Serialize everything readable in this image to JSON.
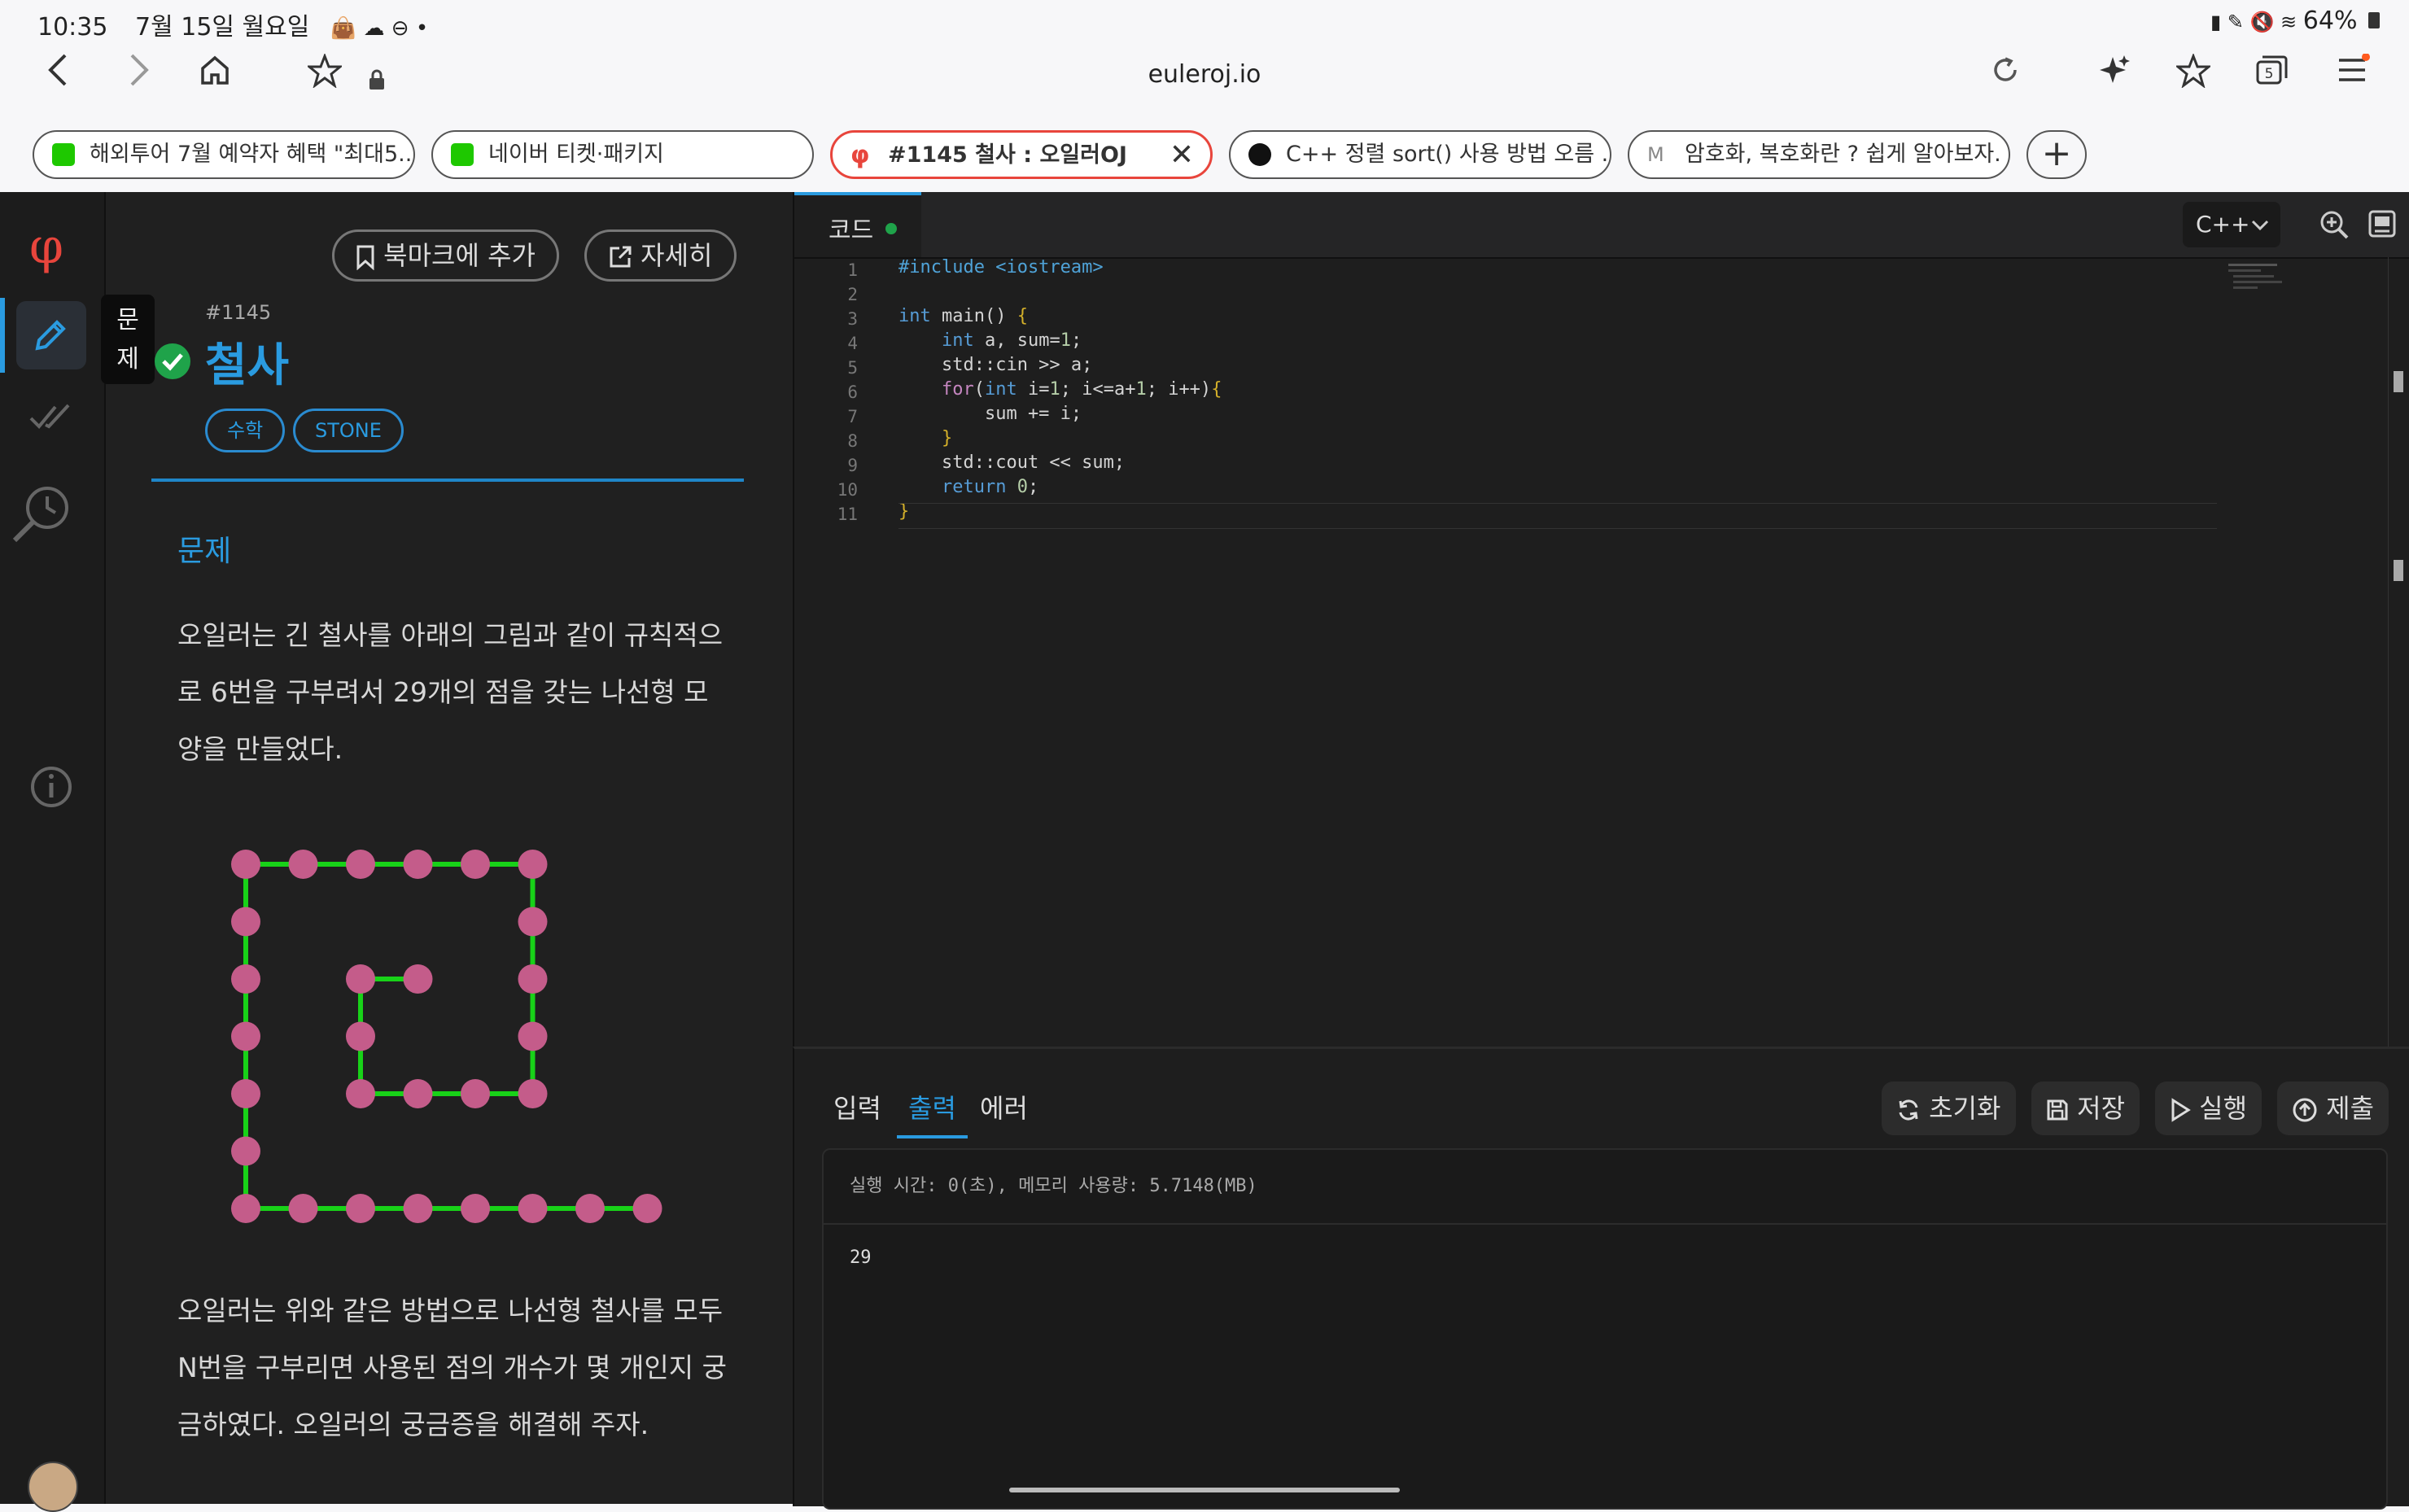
{
  "status_bar": {
    "time": "10:35",
    "date": "7월 15일 월요일",
    "left_icons": "👜 ☁ ⊖ •",
    "battery": "64%"
  },
  "browser": {
    "url": "euleroj.io",
    "tab_count": "5",
    "tabs": [
      {
        "title": "해외투어 7월 예약자 혜택 \"최대5...",
        "icon_color": "#1ec800"
      },
      {
        "title": "네이버 티켓·패키지",
        "icon_color": "#1ec800"
      },
      {
        "title": "#1145 철사 : 오일러OJ",
        "icon_color": "#e8453c"
      },
      {
        "title": "C++ 정렬 sort() 사용 방법 오름 ...",
        "icon_color": "#111111"
      },
      {
        "title": "암호화, 복호화란 ? 쉽게 알아보자.",
        "icon_color": "#888888"
      }
    ]
  },
  "sidebar": {
    "logo": "φ",
    "tooltip": "문제"
  },
  "problem": {
    "bookmark_label": "북마크에 추가",
    "detail_label": "자세히",
    "number": "#1145",
    "title": "철사",
    "tags": [
      "수학",
      "STONE"
    ],
    "section_title": "문제",
    "paragraph1": "오일러는 긴 철사를 아래의 그림과 같이 규칙적으로 6번을 구부려서 29개의 점을 갖는 나선형 모양을 만들었다.",
    "paragraph2": "오일러는 위와 같은 방법으로 나선형 철사를 모두 N번을 구부리면 사용된 점의 개수가 몇 개인지 궁금하였다. 오일러의 궁금증을 해결해 주자."
  },
  "editor": {
    "tab_label": "코드",
    "language": "C++",
    "code_lines": [
      "#include <iostream>",
      "",
      "int main() {",
      "    int a, sum=1;",
      "    std::cin >> a;",
      "    for(int i=1; i<=a+1; i++){",
      "        sum += i;",
      "    }",
      "    std::cout << sum;",
      "    return 0;",
      "}"
    ]
  },
  "io_panel": {
    "tabs": [
      "입력",
      "출력",
      "에러"
    ],
    "active_tab": "출력",
    "actions": [
      "초기화",
      "저장",
      "실행",
      "제출"
    ],
    "exec_info": "실행 시간: 0(초), 메모리 사용량: 5.7148(MB)",
    "output": "29"
  },
  "colors": {
    "accent_blue": "#2a9be0",
    "success_green": "#1fa34a",
    "wire_green": "#18d218",
    "dot_pink": "#c45c8a"
  }
}
